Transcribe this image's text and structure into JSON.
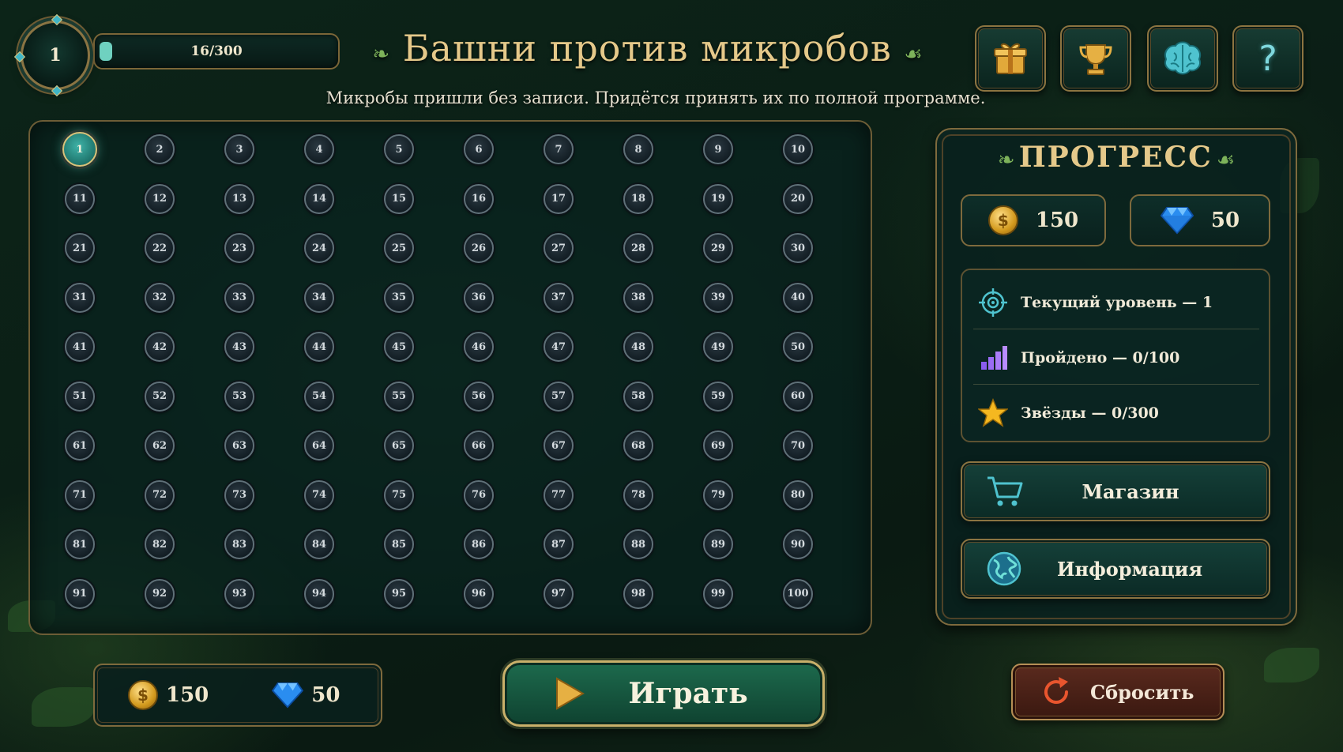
{
  "header": {
    "player_level": "1",
    "xp_text": "16/300",
    "xp_fraction": 0.053,
    "title": "Башни против микробов",
    "subtitle": "Микробы пришли без записи. Придётся принять их по полной программе."
  },
  "top_buttons": [
    {
      "name": "gift-button",
      "icon": "gift-icon"
    },
    {
      "name": "trophy-button",
      "icon": "trophy-icon"
    },
    {
      "name": "brain-button",
      "icon": "brain-icon"
    },
    {
      "name": "help-button",
      "icon": "question-icon",
      "glyph": "?"
    }
  ],
  "levels": {
    "current": 1,
    "labels": [
      "1",
      "2",
      "3",
      "4",
      "5",
      "6",
      "7",
      "8",
      "9",
      "10",
      "11",
      "12",
      "13",
      "14",
      "15",
      "16",
      "17",
      "18",
      "19",
      "20",
      "21",
      "22",
      "23",
      "24",
      "25",
      "26",
      "27",
      "28",
      "29",
      "30",
      "31",
      "32",
      "33",
      "34",
      "35",
      "36",
      "37",
      "38",
      "39",
      "40",
      "41",
      "42",
      "43",
      "44",
      "45",
      "46",
      "47",
      "48",
      "49",
      "50",
      "51",
      "52",
      "53",
      "54",
      "55",
      "56",
      "57",
      "58",
      "59",
      "60",
      "61",
      "62",
      "63",
      "64",
      "65",
      "66",
      "67",
      "68",
      "69",
      "70",
      "71",
      "72",
      "73",
      "74",
      "75",
      "76",
      "77",
      "78",
      "79",
      "80",
      "81",
      "82",
      "83",
      "84",
      "85",
      "86",
      "87",
      "88",
      "89",
      "90",
      "91",
      "92",
      "93",
      "94",
      "95",
      "96",
      "97",
      "98",
      "99",
      "100"
    ]
  },
  "progress": {
    "title": "ПРОГРЕСС",
    "coins": "150",
    "gems": "50",
    "current_level": "Текущий уровень — 1",
    "completed": "Пройдено — 0/100",
    "stars": "Звёзды — 0/300",
    "shop_label": "Магазин",
    "info_label": "Информация"
  },
  "bottom": {
    "coins": "150",
    "gems": "50",
    "play_label": "Играть",
    "reset_label": "Сбросить"
  },
  "colors": {
    "gold": "#e5c98a",
    "active_level": "#3fb3a8",
    "play_green": "#1d6a4d",
    "reset_red": "#5a2a1e"
  }
}
